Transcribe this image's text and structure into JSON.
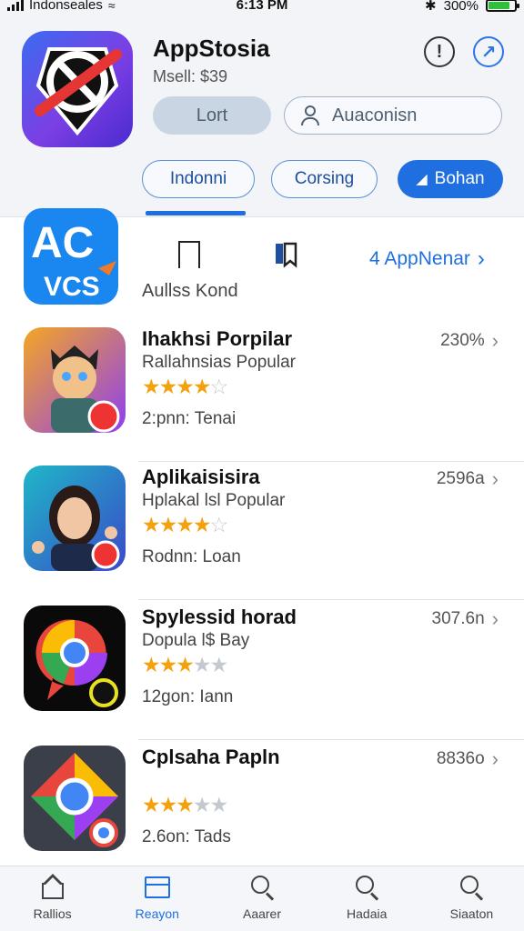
{
  "status_bar": {
    "carrier": "Indonseales",
    "time": "6:13 PM",
    "battery": "300%"
  },
  "header": {
    "title": "AppStosia",
    "subtitle": "Msell: $39",
    "grey_pill": "Lort",
    "account_pill": "Auaconisn",
    "segments": [
      "Indonni",
      "Corsing",
      "Bohan"
    ],
    "active_segment_index": 2
  },
  "featured": {
    "icon_text_top": "AC",
    "icon_text_bottom": "VCS",
    "label": "Aullss Kond",
    "link": "4 AppNenar"
  },
  "apps": [
    {
      "name": "Ihakhsi Porpilar",
      "subtitle": "Rallahnsias Popular",
      "rating": 4,
      "meta": "2:pnn: Tenai",
      "size": "230%"
    },
    {
      "name": "Aplikaisisira",
      "subtitle": "Hplakal lsl Popular",
      "rating": 4,
      "meta": "Rodnn: Loan",
      "size": "2596a"
    },
    {
      "name": "Spylessid horad",
      "subtitle": "Dopula l$ Bay",
      "rating": 3,
      "meta": "12gon: Iann",
      "size": "307.6n"
    },
    {
      "name": "Cplsaha Papln",
      "subtitle": "",
      "rating": 3,
      "meta": "2.6on: Tads",
      "size": "8836o"
    }
  ],
  "tabbar": {
    "tabs": [
      "Rallios",
      "Reayon",
      "Aaarer",
      "Hadaia",
      "Siaaton"
    ],
    "active_index": 1
  },
  "colors": {
    "accent": "#1f6fe0",
    "star": "#f3a20d",
    "header_bg": "#f2f4f8"
  }
}
